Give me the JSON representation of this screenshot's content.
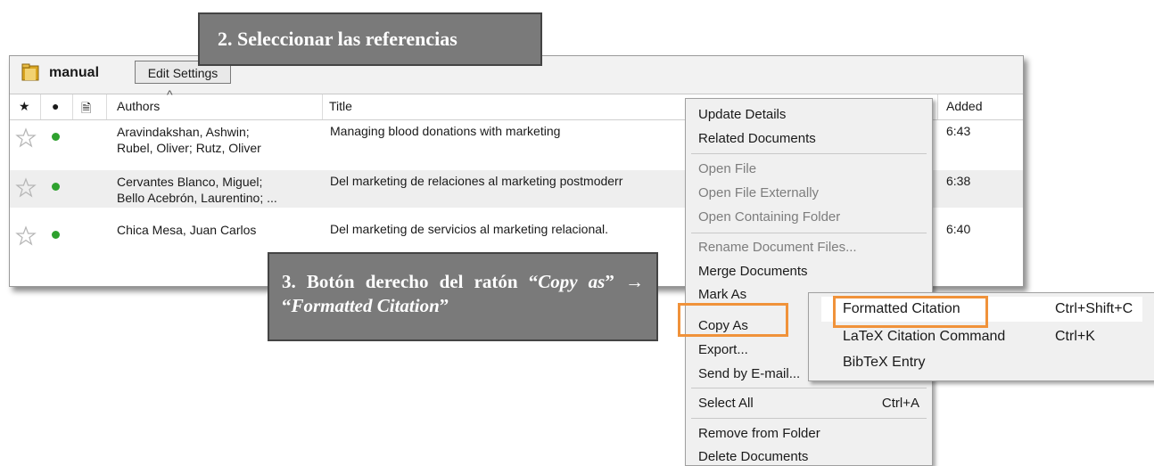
{
  "folder": {
    "name": "manual",
    "edit_settings_label": "Edit Settings"
  },
  "table": {
    "headers": {
      "star": "★",
      "read": "●",
      "doc": "🗎",
      "authors": "Authors",
      "title": "Title",
      "added": "Added"
    },
    "rows": [
      {
        "authors_line1": "Aravindakshan, Ashwin;",
        "authors_line2": "Rubel, Oliver; Rutz, Oliver",
        "title": "Managing blood donations with marketing",
        "added": "6:43"
      },
      {
        "authors_line1": "Cervantes Blanco, Miguel;",
        "authors_line2": "Bello Acebrón, Laurentino; ...",
        "title": "Del marketing de relaciones al marketing postmoderr",
        "added": "6:38"
      },
      {
        "authors_line1": "Chica Mesa, Juan Carlos",
        "authors_line2": "",
        "title": "Del marketing de servicios al marketing relacional.",
        "added": "6:40"
      }
    ]
  },
  "callouts": {
    "step2": "2. Seleccionar las referencias",
    "step3_a": "3. Botón derecho del ratón “",
    "step3_b": "Copy as",
    "step3_c": "” → “",
    "step3_d": "Formatted Citation",
    "step3_e": "”"
  },
  "context_menu": {
    "update_details": "Update Details",
    "related_documents": "Related Documents",
    "open_file": "Open File",
    "open_file_externally": "Open File Externally",
    "open_containing_folder": "Open Containing Folder",
    "rename_document_files": "Rename Document Files...",
    "merge_documents": "Merge Documents",
    "mark_as": "Mark As",
    "copy_as": "Copy As",
    "export": "Export...",
    "send_by_email": "Send by E-mail...",
    "select_all": "Select All",
    "select_all_shortcut": "Ctrl+A",
    "remove_from_folder": "Remove from Folder",
    "delete_documents": "Delete Documents"
  },
  "submenu": {
    "formatted_citation": "Formatted Citation",
    "formatted_citation_shortcut": "Ctrl+Shift+C",
    "latex_citation": "LaTeX Citation Command",
    "latex_citation_shortcut": "Ctrl+K",
    "bibtex_entry": "BibTeX Entry"
  },
  "colors": {
    "highlight": "#f0923a",
    "callout_bg": "#7a7a7a",
    "read_dot": "#2ea12e"
  }
}
